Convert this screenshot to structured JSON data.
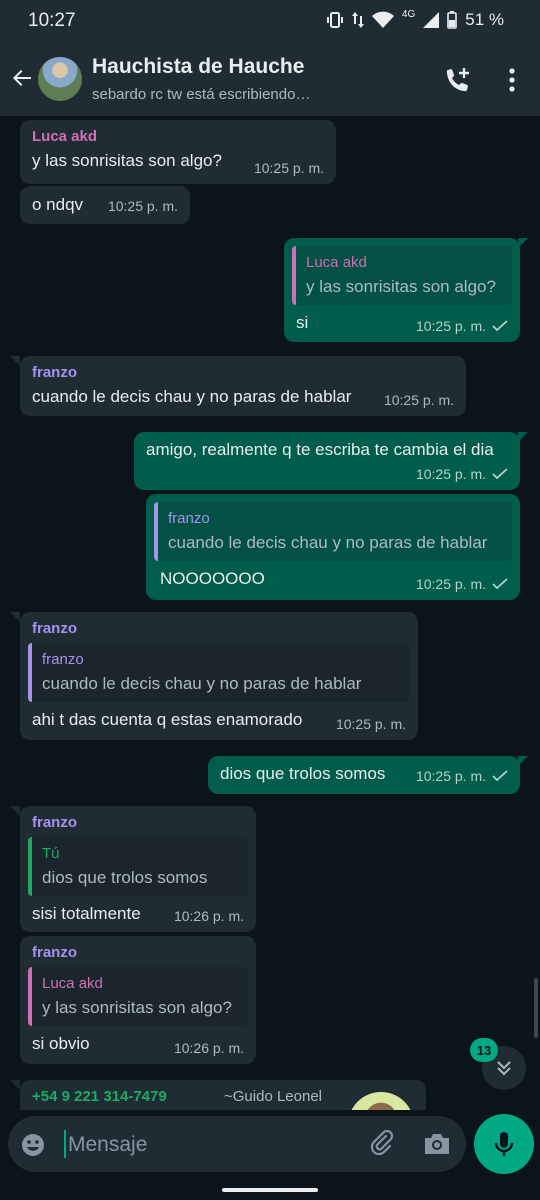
{
  "statusbar": {
    "time": "10:27",
    "network": "4G",
    "battery": "51 %"
  },
  "header": {
    "title": "Hauchista de Hauche",
    "subtitle": "sebardo rc tw está escribiendo…"
  },
  "colors": {
    "luca": "#d16fb5",
    "franzo": "#a593ec",
    "tu": "#1daa61",
    "number": "#1daa61",
    "accent": "#00a884"
  },
  "messages": [
    {
      "sender": "Luca akd",
      "text": "y las sonrisitas son algo?",
      "time": "10:25 p. m."
    },
    {
      "text": "o ndqv",
      "time": "10:25 p. m."
    },
    {
      "quote_name": "Luca akd",
      "quote_text": "y las sonrisitas son algo?",
      "text": "si",
      "time": "10:25 p. m."
    },
    {
      "sender": "franzo",
      "text": "cuando le decis chau y no paras de hablar",
      "time": "10:25 p. m."
    },
    {
      "text": "amigo, realmente q te escriba te cambia el dia",
      "time": "10:25 p. m."
    },
    {
      "quote_name": "franzo",
      "quote_text": "cuando le decis chau y no paras de hablar",
      "text": "NOOOOOOO",
      "time": "10:25 p. m."
    },
    {
      "sender": "franzo",
      "quote_name": "franzo",
      "quote_text": "cuando le decis chau y no paras de hablar",
      "text": "ahi t das cuenta q estas enamorado",
      "time": "10:25 p. m."
    },
    {
      "text": "dios que trolos somos",
      "time": "10:25 p. m."
    },
    {
      "sender": "franzo",
      "quote_name": "Tú",
      "quote_text": "dios que trolos somos",
      "text": "sisi totalmente",
      "time": "10:26 p. m."
    },
    {
      "sender": "franzo",
      "quote_name": "Luca akd",
      "quote_text": "y las sonrisitas son algo?",
      "text": "si obvio",
      "time": "10:26 p. m."
    },
    {
      "sender_number": "+54 9 221 314-7479",
      "sender_alias": "~Guido Leonel"
    }
  ],
  "unread_badge": "13",
  "composer": {
    "placeholder": "Mensaje"
  }
}
